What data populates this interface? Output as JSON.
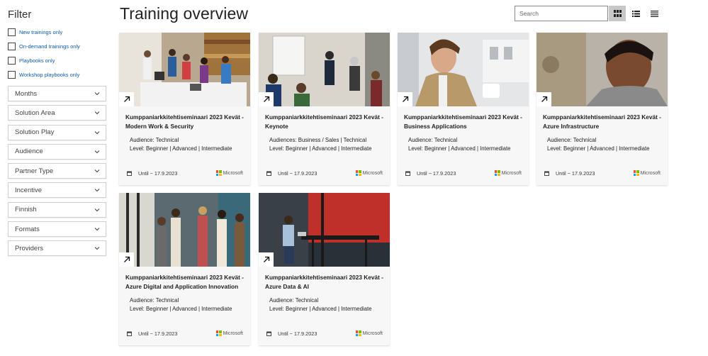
{
  "sidebar": {
    "title": "Filter",
    "checkboxes": [
      {
        "label": "New trainings only"
      },
      {
        "label": "On-demand trainings only"
      },
      {
        "label": "Playbooks only"
      },
      {
        "label": "Workshop playbooks only"
      }
    ],
    "dropdowns": [
      {
        "label": "Months"
      },
      {
        "label": "Solution Area"
      },
      {
        "label": "Solution Play"
      },
      {
        "label": "Audience"
      },
      {
        "label": "Partner Type"
      },
      {
        "label": "Incentive"
      },
      {
        "label": "Finnish"
      },
      {
        "label": "Formats"
      },
      {
        "label": "Providers"
      }
    ]
  },
  "header": {
    "title": "Training overview",
    "search_placeholder": "Search",
    "view_buttons": [
      "grid-view-icon",
      "list-view-icon",
      "compact-list-icon"
    ],
    "active_view": "grid"
  },
  "colors": {
    "link": "#0b5cad",
    "active_view_bg": "#c8c8c8",
    "card_bg": "#f7f7f7",
    "ms_red": "#f25022",
    "ms_green": "#7fba00",
    "ms_blue": "#00a4ef",
    "ms_yellow": "#ffb900"
  },
  "cards": [
    {
      "title": "Kumppaniarkkitehtiseminaari 2023 Kevät - Modern Work & Security",
      "audience": "Audience: Technical",
      "level": "Level: Beginner | Advanced | Intermediate",
      "until": "Until ~ 17.9.2023",
      "provider": "Microsoft"
    },
    {
      "title": "Kumppaniarkkitehtiseminaari 2023 Kevät - Keynote",
      "audience": "Audiences: Business / Sales | Technical",
      "level": "Level: Beginner | Advanced | Intermediate",
      "until": "Until ~ 17.9.2023",
      "provider": "Microsoft"
    },
    {
      "title": "Kumppaniarkkitehtiseminaari 2023 Kevät - Business Applications",
      "audience": "Audience: Technical",
      "level": "Level: Beginner | Advanced | Intermediate",
      "until": "Until ~ 17.9.2023",
      "provider": "Microsoft"
    },
    {
      "title": "Kumppaniarkkitehtiseminaari 2023 Kevät - Azure Infrastructure",
      "audience": "Audience: Technical",
      "level": "Level: Beginner | Advanced | Intermediate",
      "until": "Until ~ 17.9.2023",
      "provider": "Microsoft"
    },
    {
      "title": "Kumppaniarkkitehtiseminaari 2023 Kevät - Azure Digital and Application Innovation",
      "audience": "Audience: Technical",
      "level": "Level: Beginner | Advanced | Intermediate",
      "until": "Until ~ 17.9.2023",
      "provider": "Microsoft"
    },
    {
      "title": "Kumppaniarkkitehtiseminaari 2023 Kevät - Azure Data & AI",
      "audience": "Audience: Technical",
      "level": "Level: Beginner | Advanced | Intermediate",
      "until": "Until ~ 17.9.2023",
      "provider": "Microsoft"
    }
  ]
}
